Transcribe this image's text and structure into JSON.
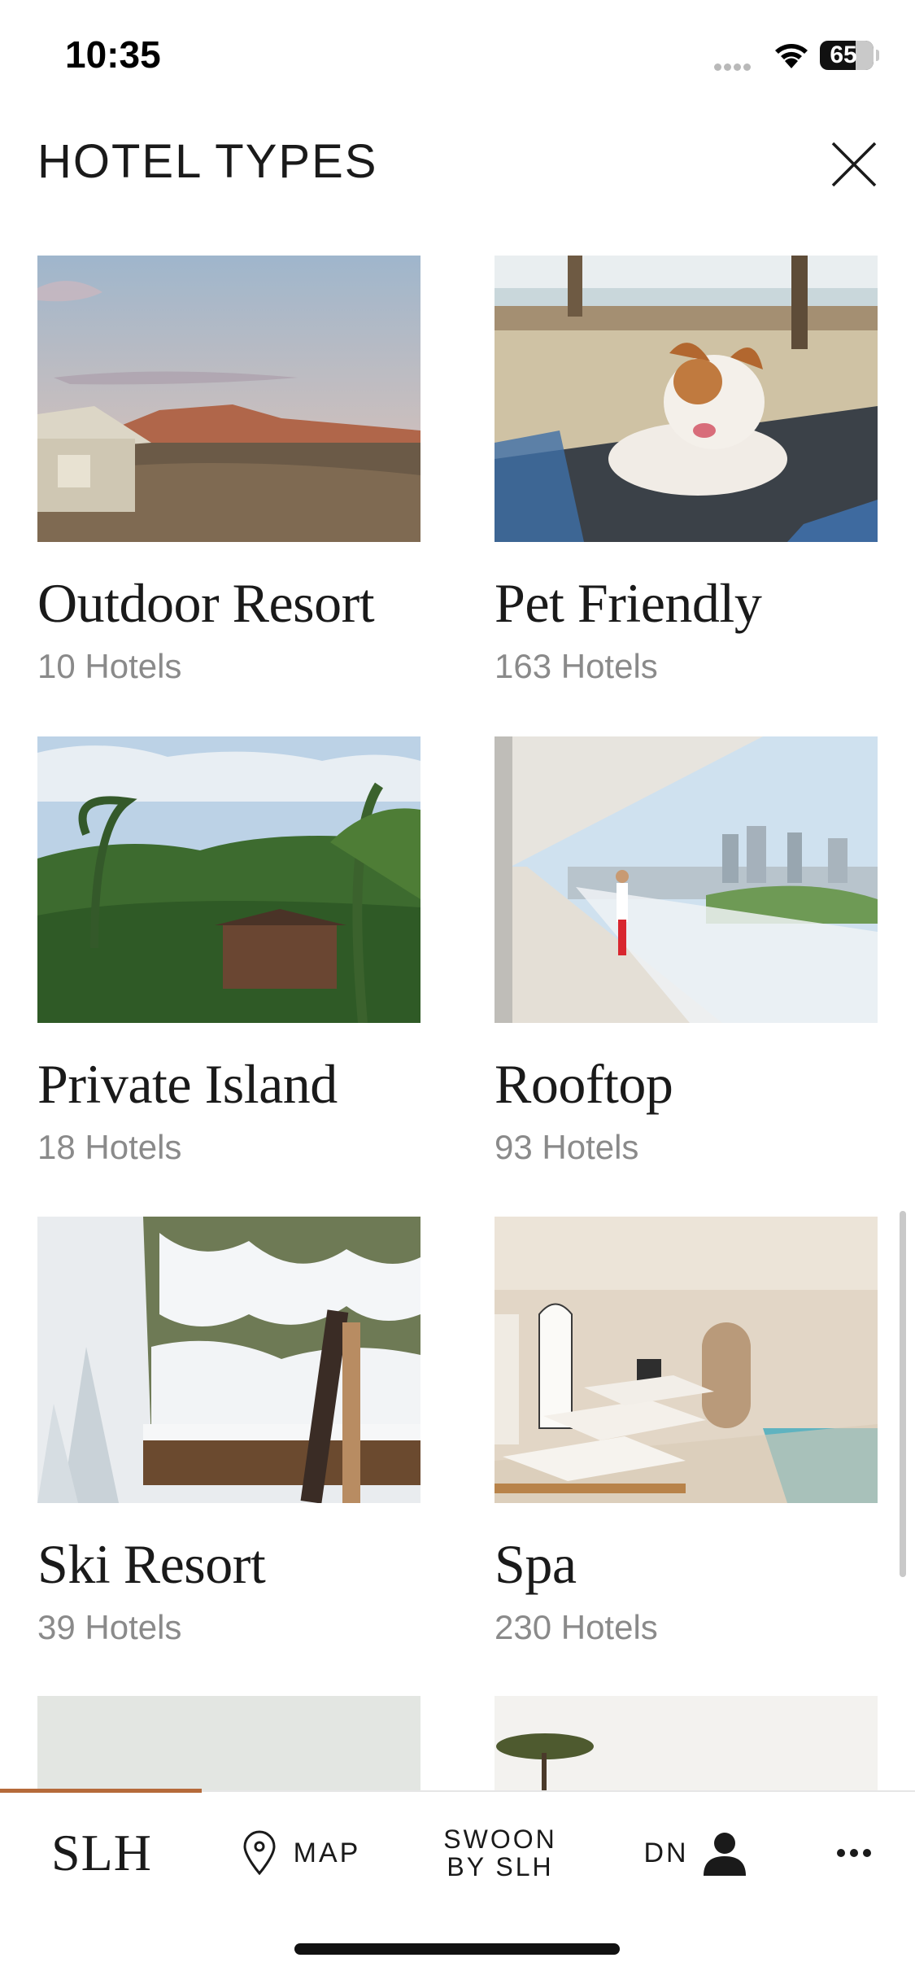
{
  "status": {
    "time": "10:35",
    "battery": "65"
  },
  "header": {
    "title": "HOTEL TYPES"
  },
  "hotel_types": [
    {
      "name": "Outdoor Resort",
      "count": "10 Hotels"
    },
    {
      "name": "Pet Friendly",
      "count": "163 Hotels"
    },
    {
      "name": "Private Island",
      "count": "18 Hotels"
    },
    {
      "name": "Rooftop",
      "count": "93 Hotels"
    },
    {
      "name": "Ski Resort",
      "count": "39 Hotels"
    },
    {
      "name": "Spa",
      "count": "230 Hotels"
    }
  ],
  "tab_bar": {
    "logo": "SLH",
    "map_label": "MAP",
    "swoon_line1": "SWOON",
    "swoon_line2": "BY SLH",
    "profile_initials": "DN",
    "more_icon": "more-icon"
  },
  "colors": {
    "accent": "#b56a3a",
    "muted_text": "#8a8a8a"
  }
}
